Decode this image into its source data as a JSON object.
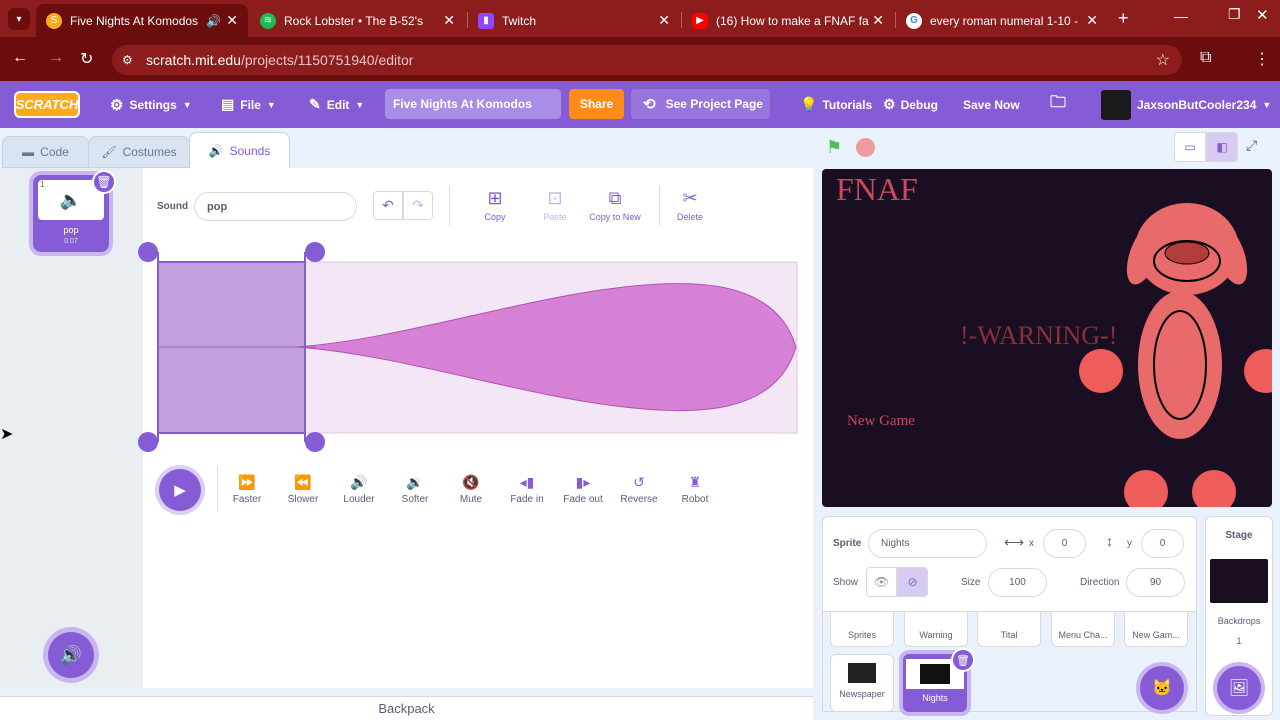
{
  "browser": {
    "tabs": [
      {
        "title": "Five Nights At Komodos",
        "favicon": "scratch-icon",
        "active": true
      },
      {
        "title": "Rock Lobster • The B-52's",
        "favicon": "spotify-icon"
      },
      {
        "title": "Twitch",
        "favicon": "twitch-icon"
      },
      {
        "title": "(16) How to make a FNAF fa",
        "favicon": "youtube-icon"
      },
      {
        "title": "every roman numeral 1-10 - G",
        "favicon": "google-icon"
      }
    ],
    "url_host": "scratch.mit.edu",
    "url_path": "/projects/1150751940/editor"
  },
  "menu": {
    "logo": "SCRATCH",
    "settings": "Settings",
    "file": "File",
    "edit": "Edit",
    "project_title": "Five Nights At Komodos",
    "share": "Share",
    "see_project": "See Project Page",
    "tutorials": "Tutorials",
    "debug": "Debug",
    "save_now": "Save Now",
    "username": "JaxsonButCooler234"
  },
  "editor_tabs": {
    "code": "Code",
    "costumes": "Costumes",
    "sounds": "Sounds"
  },
  "sound_list": [
    {
      "index": "1",
      "name": "pop",
      "duration": "0.07"
    }
  ],
  "sound_editor": {
    "sound_label": "Sound",
    "sound_name": "pop",
    "tools": {
      "copy": "Copy",
      "paste": "Paste",
      "copy_to_new": "Copy to New",
      "delete": "Delete"
    },
    "effects": [
      "Faster",
      "Slower",
      "Louder",
      "Softer",
      "Mute",
      "Fade in",
      "Fade out",
      "Reverse",
      "Robot"
    ]
  },
  "backpack": "Backpack",
  "stage": {
    "fnaf": "FNAF",
    "warning": "!-WARNING-!",
    "new_game": "New Game"
  },
  "sprite_info": {
    "sprite_label": "Sprite",
    "sprite_name": "Nights",
    "x_label": "x",
    "x": "0",
    "y_label": "y",
    "y": "0",
    "show_label": "Show",
    "size_label": "Size",
    "size": "100",
    "direction_label": "Direction",
    "direction": "90"
  },
  "sprites_row1": [
    "Sprites",
    "Warning",
    "Tital",
    "Menu Cha...",
    "New Gam..."
  ],
  "sprites_row2": [
    "Newspaper",
    "Nights"
  ],
  "stage_panel": {
    "title": "Stage",
    "backdrops_label": "Backdrops",
    "backdrops_count": "1"
  },
  "colors": {
    "scratch_purple": "#855cd6",
    "browser_red": "#8d1d1d",
    "share_orange": "#ff8c1a",
    "stage_bg": "#1a0f22",
    "stage_text": "#c94a5a"
  }
}
